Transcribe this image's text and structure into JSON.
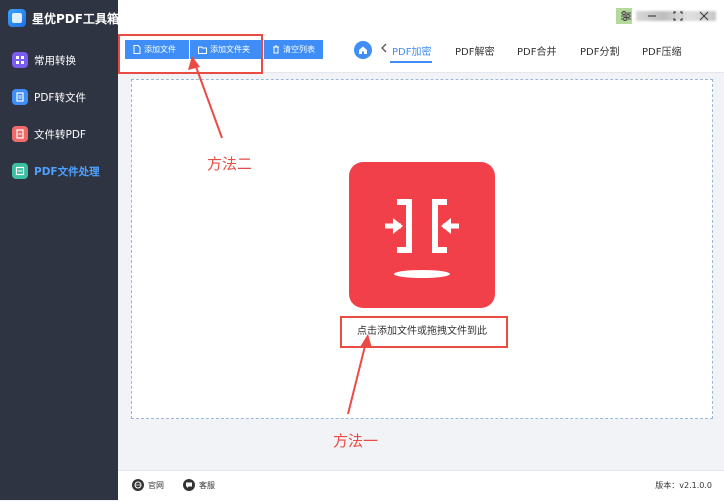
{
  "app": {
    "title": "星优PDF工具箱"
  },
  "sidebar": {
    "items": [
      {
        "label": "常用转换",
        "icon": "grid-icon",
        "color": "#7b5cf0"
      },
      {
        "label": "PDF转文件",
        "icon": "pdf-to-file-icon",
        "color": "#3f8ef7"
      },
      {
        "label": "文件转PDF",
        "icon": "file-to-pdf-icon",
        "color": "#f06a6a"
      },
      {
        "label": "PDF文件处理",
        "icon": "pdf-process-icon",
        "color": "#3cbfa3",
        "active": true
      }
    ]
  },
  "toolbar": {
    "add_file": "添加文件",
    "add_folder": "添加文件夹",
    "clear_list": "清空列表"
  },
  "tabs": [
    {
      "label": "PDF加密",
      "active": true
    },
    {
      "label": "PDF解密"
    },
    {
      "label": "PDF合并"
    },
    {
      "label": "PDF分割"
    },
    {
      "label": "PDF压缩"
    }
  ],
  "dropzone": {
    "text": "点击添加文件或拖拽文件到此"
  },
  "annotations": {
    "method_two": "方法二",
    "method_one": "方法一"
  },
  "footer": {
    "website": "官网",
    "support": "客服",
    "version": "版本：v2.1.0.0"
  },
  "colors": {
    "accent": "#3f8ef7",
    "sidebar_bg": "#2f3443",
    "drop_icon": "#f2404a",
    "annotation": "#e84c45"
  }
}
